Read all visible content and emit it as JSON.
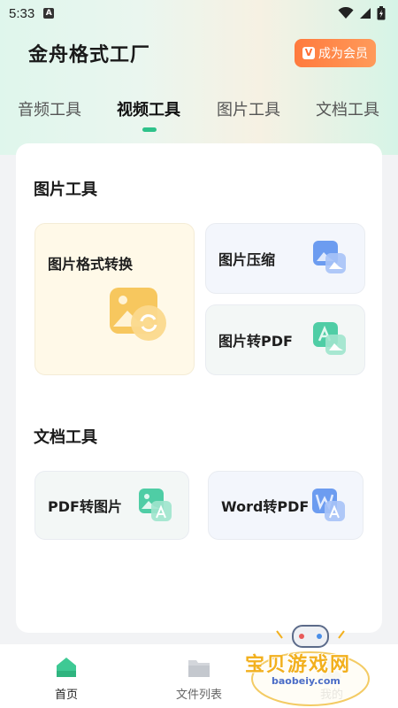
{
  "status_bar": {
    "time": "5:33",
    "app_badge": "A"
  },
  "header": {
    "title": "金舟格式工厂",
    "vip_badge": "V",
    "vip_label": "成为会员"
  },
  "tabs": [
    {
      "label": "音频工具"
    },
    {
      "label": "视频工具",
      "active": true
    },
    {
      "label": "图片工具"
    },
    {
      "label": "文档工具"
    }
  ],
  "sections": {
    "image_tools": {
      "title": "图片工具",
      "items": [
        {
          "label": "图片格式转换",
          "icon": "image-convert-icon"
        },
        {
          "label": "图片压缩",
          "icon": "image-compress-icon"
        },
        {
          "label": "图片转PDF",
          "icon": "image-to-pdf-icon"
        }
      ]
    },
    "doc_tools": {
      "title": "文档工具",
      "items": [
        {
          "label": "PDF转图片",
          "icon": "pdf-to-image-icon"
        },
        {
          "label": "Word转PDF",
          "icon": "word-to-pdf-icon"
        }
      ]
    }
  },
  "bottom_nav": [
    {
      "label": "首页",
      "icon": "home-icon",
      "active": true
    },
    {
      "label": "文件列表",
      "icon": "folder-icon"
    },
    {
      "label": "我的",
      "icon": "profile-icon"
    }
  ],
  "watermark": {
    "text": "宝贝游戏网",
    "url": "baobeiy.com"
  },
  "colors": {
    "accent": "#2ec28a",
    "vip": "#ff7a3d",
    "image_card_bg": "#fff9e8"
  }
}
